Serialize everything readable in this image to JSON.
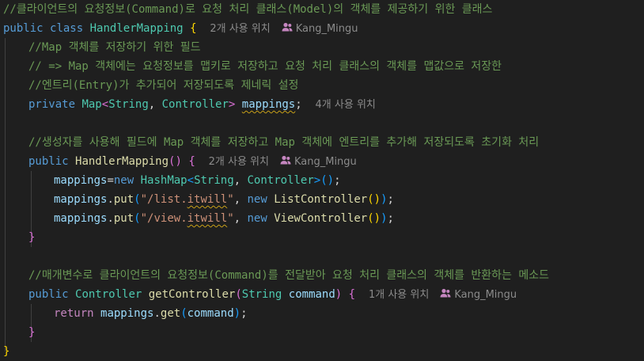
{
  "editor": {
    "colors": {
      "background": "#1f1f1f",
      "comment": "#6a9955",
      "keyword": "#569cd6",
      "type": "#4ec9b0",
      "string": "#ce9178"
    },
    "comments": {
      "c1": "//클라이언트의 요청정보(Command)로 요청 처리 클래스(Model)의 객체를 제공하기 위한 클래스",
      "c2": "//Map 객체를 저장하기 위한 필드",
      "c3": "// => Map 객체에는 요청정보를 맵키로 저장하고 요청 처리 클래스의 객체를 맵값으로 저장한",
      "c4": "//엔트리(Entry)가 추가되어 저장되도록 제네릭 설정",
      "c5": "//생성자를 사용해 필드에 Map 객체를 저장하고 Map 객체에 엔트리를 추가해 저장되도록 초기화 처리",
      "c6": "//매개변수로 클라이언트의 요청정보(Command)를 전달받아 요청 처리 클래스의 객체를 반환하는 메소드"
    },
    "keywords": {
      "public": "public",
      "class": "class",
      "private": "private",
      "new": "new",
      "return": "return"
    },
    "types": {
      "handler_mapping": "HandlerMapping",
      "map": "Map",
      "string": "String",
      "controller": "Controller",
      "hash_map": "HashMap",
      "list_controller": "ListController",
      "view_controller": "ViewController"
    },
    "identifiers": {
      "mappings": "mappings",
      "put": "put",
      "get": "get",
      "get_controller": "getController",
      "command": "command"
    },
    "strings": {
      "list_q": "\"",
      "list_path": "/list.",
      "list_word": "itwill",
      "view_path": "/view.",
      "view_word": "itwill"
    },
    "hints": {
      "class_usages": "2개 사용 위치",
      "field_usages": "4개 사용 위치",
      "ctor_usages": "2개 사용 위치",
      "method_usages": "1개 사용 위치",
      "author": "Kang_Mingu"
    }
  }
}
